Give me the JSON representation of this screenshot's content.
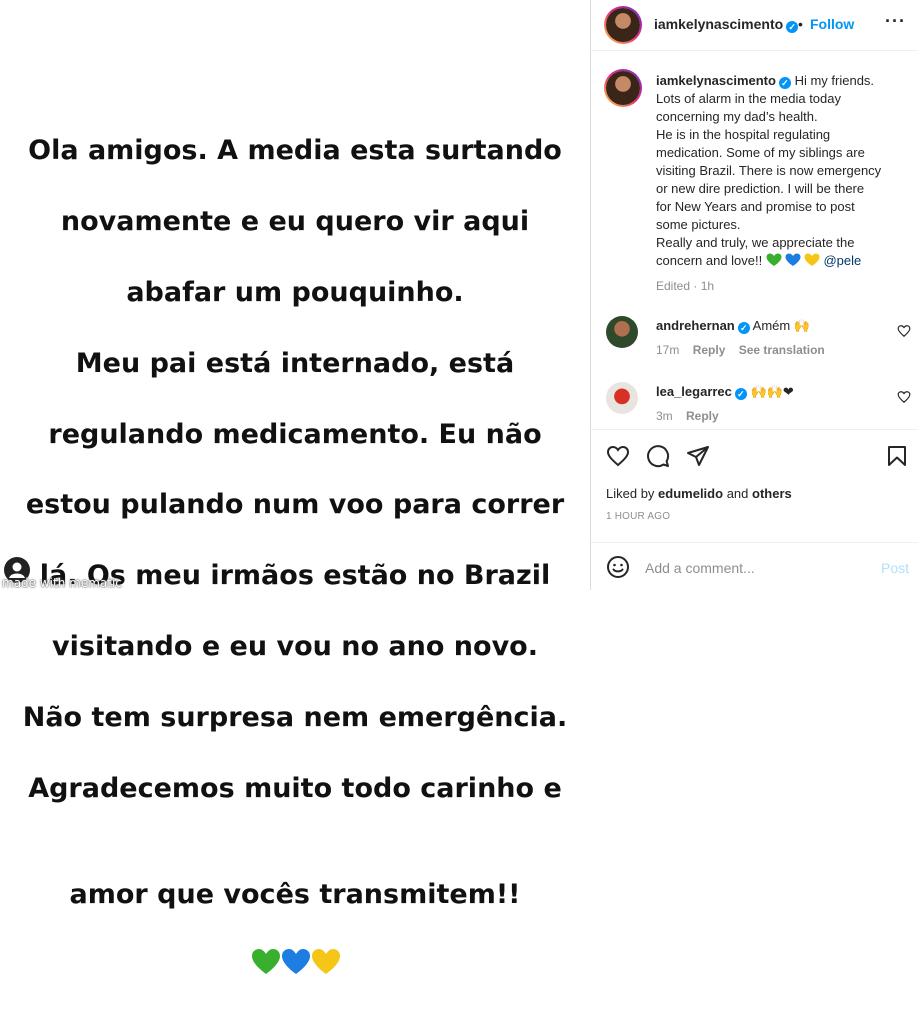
{
  "story": {
    "lines": [
      "Ola amigos. A media esta surtando",
      "novamente e eu quero vir aqui",
      "abafar um pouquinho.",
      "Meu pai está internado, está",
      "regulando medicamento. Eu não",
      "estou pulando num voo para correr",
      "lá. Os meu irmãos estão no Brazil",
      "visitando e eu vou no ano novo.",
      "Não tem surpresa nem emergência.",
      "Agradecemos muito todo carinho e",
      "amor que vocês transmitem!!"
    ],
    "hearts": [
      "#39b02d",
      "#1d7de0",
      "#f5c518"
    ],
    "watermark": "made with mematic"
  },
  "header": {
    "username": "iamkelynascimento",
    "separator": "•",
    "follow_label": "Follow",
    "more_icon": "more-horizontal-icon"
  },
  "caption": {
    "username": "iamkelynascimento",
    "lines": [
      "Hi my friends.",
      "Lots of alarm in the media today",
      "concerning my dad’s health.",
      "He is in the hospital regulating",
      "medication. Some of my siblings are",
      "visiting Brazil. There is now emergency",
      "or new dire prediction. I will be there",
      "for New Years and promise to post",
      "some pictures.",
      "Really and truly, we appreciate the",
      "concern and love!!"
    ],
    "mention": "@pele",
    "edited": "Edited",
    "time": "1h"
  },
  "comments": [
    {
      "username": "andrehernan",
      "text": "Amém 🙌",
      "time": "17m",
      "reply": "Reply",
      "translate": "See translation"
    },
    {
      "username": "lea_legarrec",
      "text": "🙌🙌❤",
      "time": "3m",
      "reply": "Reply"
    }
  ],
  "footer": {
    "liked_prefix": "Liked by",
    "liked_user": "edumelido",
    "liked_and": "and",
    "liked_others": "others",
    "timestamp": "1 HOUR AGO",
    "comment_placeholder": "Add a comment...",
    "post_label": "Post"
  },
  "colors": {
    "accent": "#0095f6",
    "text": "#262626",
    "muted": "#8e8e8e",
    "border": "#dbdbdb"
  }
}
